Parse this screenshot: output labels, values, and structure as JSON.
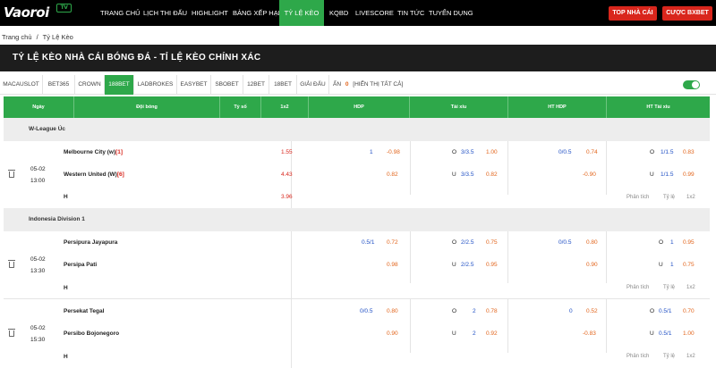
{
  "header": {
    "logo": {
      "text": "Vaoroi",
      "badge": "TV"
    },
    "nav": [
      "TRANG CHỦ",
      "LỊCH THI ĐẤU",
      "HIGHLIGHT",
      "BẢNG XẾP HẠNG",
      "TỶ LỆ KÈO",
      "KQBD",
      "LIVESCORE",
      "TIN TỨC",
      "TUYỂN DỤNG"
    ],
    "active_nav": "TỶ LỆ KÈO",
    "buttons": {
      "top_nha_cai": "TOP NHÀ CÁI",
      "cuoc_bxbet": "CƯỢC BXBET"
    }
  },
  "breadcrumb": {
    "home": "Trang chủ",
    "sep": "/",
    "current": "Tỷ Lệ Kèo"
  },
  "page_title": "TỶ LỆ KÈO NHÀ CÁI BÓNG ĐÁ - TỈ LỆ KÈO CHÍNH XÁC",
  "bookmakers": [
    "MACAUSLOT",
    "BET365",
    "CROWN",
    "188BET",
    "LADBROKES",
    "EASYBET",
    "SBOBET",
    "12BET",
    "18BET",
    "GIẢI ĐẤU"
  ],
  "active_bookmaker": "188BET",
  "hidden": {
    "label": "ẨN",
    "count": "0",
    "show_all": "[HIỂN THỊ TẤT CẢ]"
  },
  "columns": [
    "Ngày",
    "Đội bóng",
    "Tỷ số",
    "1x2",
    "HDP",
    "Tài xỉu",
    "HT HDP",
    "HT Tài xỉu"
  ],
  "colors": {
    "green": "#2ea84a",
    "red": "#d9261c",
    "orange": "#e2641b",
    "blue": "#1f4fc4"
  },
  "leagues": [
    {
      "name": "W-League Úc",
      "matches": [
        {
          "date": "05-02",
          "time": "13:00",
          "home": {
            "name": "Melbourne City (w)",
            "rank": "[1]"
          },
          "away": {
            "name": "Western United (W)",
            "rank": "[6]"
          },
          "draw_label": "H",
          "x12": {
            "home": "1.55",
            "away": "4.43",
            "draw": "3.96"
          },
          "hdp": {
            "home_line": "1",
            "home_odd": "-0.98",
            "away_odd": "0.82"
          },
          "ou": {
            "over_side": "O",
            "over_line": "3/3.5",
            "over_odd": "1.00",
            "under_side": "U",
            "under_line": "3/3.5",
            "under_odd": "0.82"
          },
          "ht_hdp": {
            "home_line": "0/0.5",
            "home_odd": "0.74",
            "away_odd": "-0.90"
          },
          "ht_ou": {
            "over_side": "O",
            "over_line": "1/1.5",
            "over_odd": "0.83",
            "under_side": "U",
            "under_line": "1/1.5",
            "under_odd": "0.99"
          },
          "links": {
            "analysis": "Phân tích",
            "odds": "Tỷ lệ",
            "x12": "1x2"
          }
        }
      ]
    },
    {
      "name": "Indonesia Division 1",
      "matches": [
        {
          "date": "05-02",
          "time": "13:30",
          "home": {
            "name": "Persipura Jayapura",
            "rank": ""
          },
          "away": {
            "name": "Persipa Pati",
            "rank": ""
          },
          "draw_label": "H",
          "hdp": {
            "home_line": "0.5/1",
            "home_odd": "0.72",
            "away_odd": "0.98"
          },
          "ou": {
            "over_side": "O",
            "over_line": "2/2.5",
            "over_odd": "0.75",
            "under_side": "U",
            "under_line": "2/2.5",
            "under_odd": "0.95"
          },
          "ht_hdp": {
            "home_line": "0/0.5",
            "home_odd": "0.80",
            "away_odd": "0.90"
          },
          "ht_ou": {
            "over_side": "O",
            "over_line": "1",
            "over_odd": "0.95",
            "under_side": "U",
            "under_line": "1",
            "under_odd": "0.75"
          },
          "links": {
            "analysis": "Phân tích",
            "odds": "Tỷ lệ",
            "x12": "1x2"
          }
        },
        {
          "date": "05-02",
          "time": "15:30",
          "home": {
            "name": "Persekat Tegal",
            "rank": ""
          },
          "away": {
            "name": "Persibo Bojonegoro",
            "rank": ""
          },
          "draw_label": "H",
          "hdp": {
            "home_line": "0/0.5",
            "home_odd": "0.80",
            "away_odd": "0.90"
          },
          "ou": {
            "over_side": "O",
            "over_line": "2",
            "over_odd": "0.78",
            "under_side": "U",
            "under_line": "2",
            "under_odd": "0.92"
          },
          "ht_hdp": {
            "home_line": "0",
            "home_odd": "0.52",
            "away_odd": "-0.83"
          },
          "ht_ou": {
            "over_side": "O",
            "over_line": "0.5/1",
            "over_odd": "0.70",
            "under_side": "U",
            "under_line": "0.5/1",
            "under_odd": "1.00"
          },
          "links": {
            "analysis": "Phân tích",
            "odds": "Tỷ lệ",
            "x12": "1x2"
          }
        }
      ]
    }
  ]
}
